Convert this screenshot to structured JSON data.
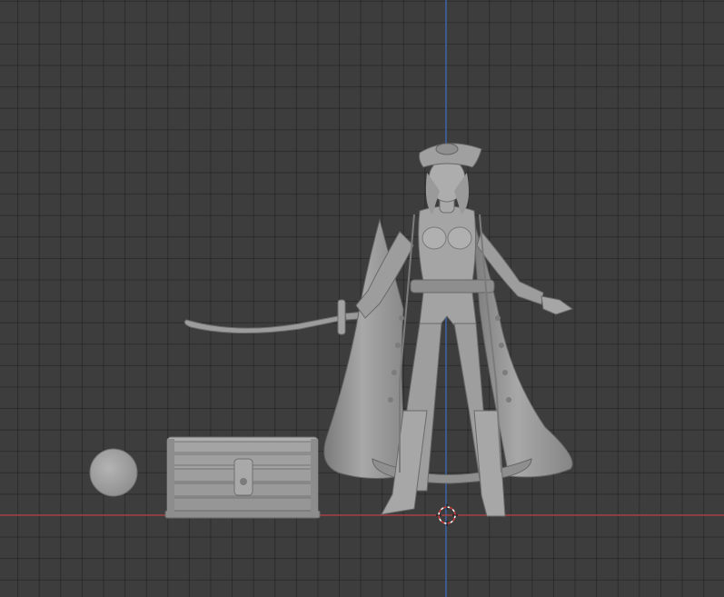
{
  "viewport": {
    "background": "#3d3d3d",
    "grid_color": "#2f2f2f",
    "x_axis_color": "#a8444a",
    "z_axis_color": "#3f67a8",
    "mesh_color": "#9b9b9b",
    "mesh_shadow": "#6f6f6f",
    "mesh_highlight": "#b7b7b7"
  },
  "scene": {
    "objects": [
      "pirate-woman-figure",
      "treasure-chest",
      "round-base",
      "saber-sword"
    ],
    "cursor": "3d-cursor-icon"
  }
}
